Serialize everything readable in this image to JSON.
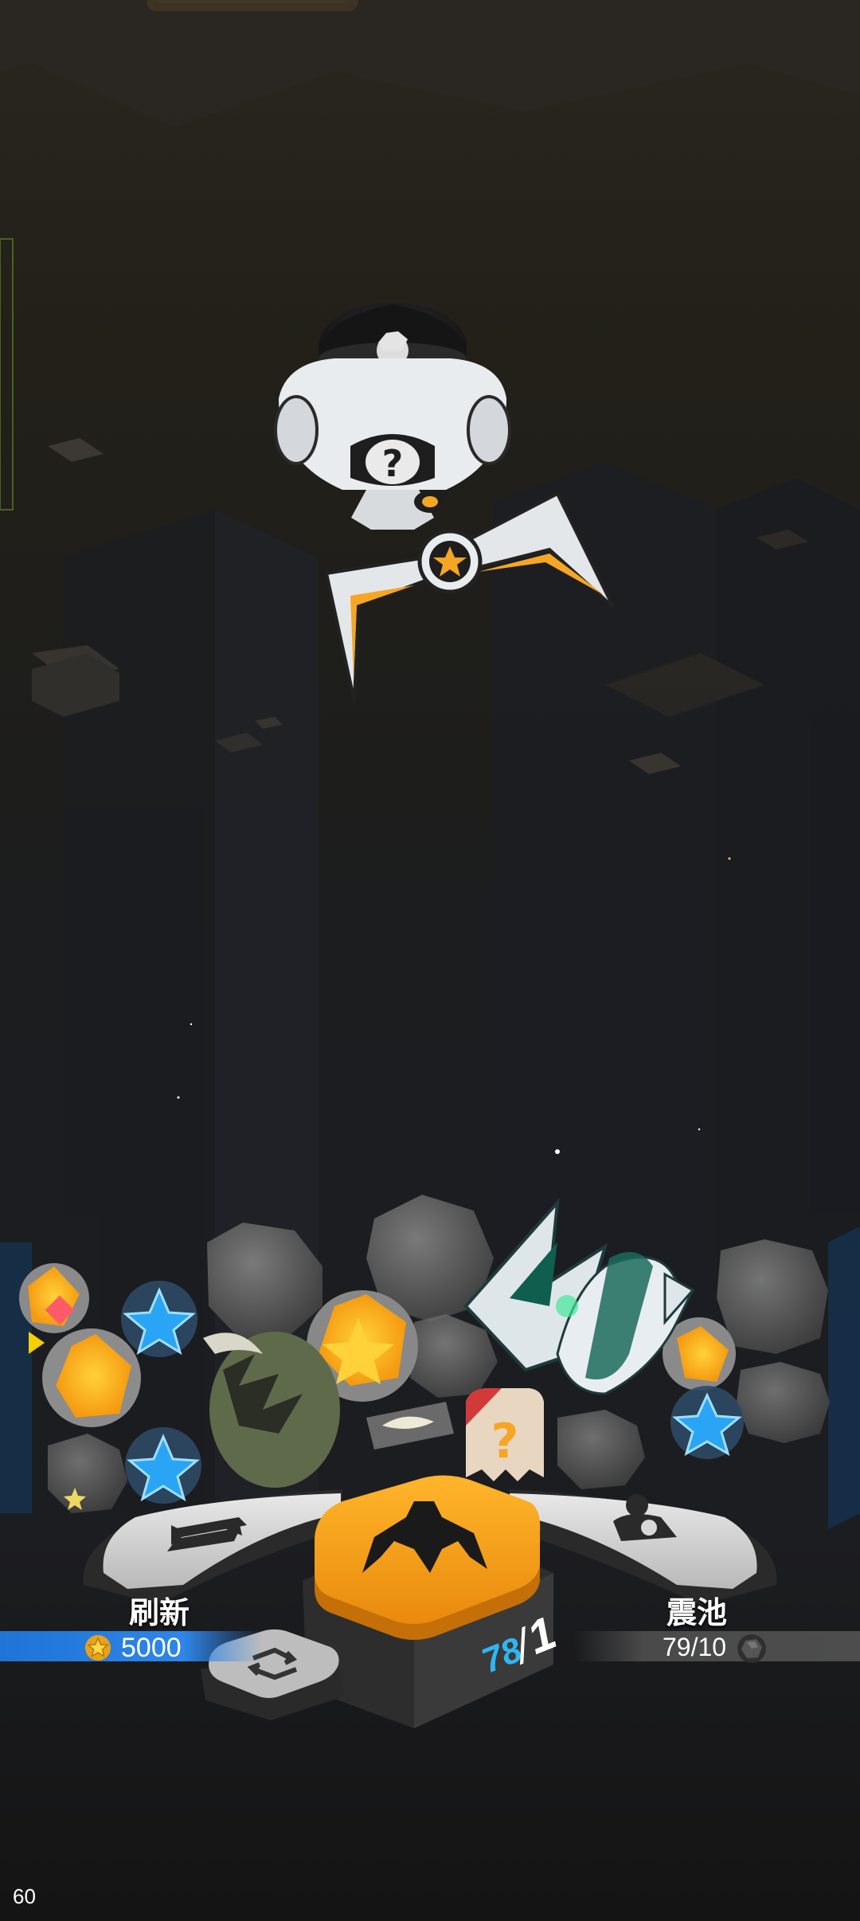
{
  "actions": {
    "refresh": {
      "label": "刷新",
      "cost": "5000",
      "icon": "refresh-icon"
    },
    "pool": {
      "label": "震池",
      "count": "79/10",
      "icon": "ore-icon"
    },
    "main": {
      "icon": "claw-icon",
      "current": "78",
      "slash": "/",
      "max": "1"
    }
  },
  "hud": {
    "fps": "60"
  },
  "colors": {
    "accent_orange": "#f5a623",
    "refresh_blue": "#2e86e8",
    "counter_cyan": "#2fb6f2"
  }
}
